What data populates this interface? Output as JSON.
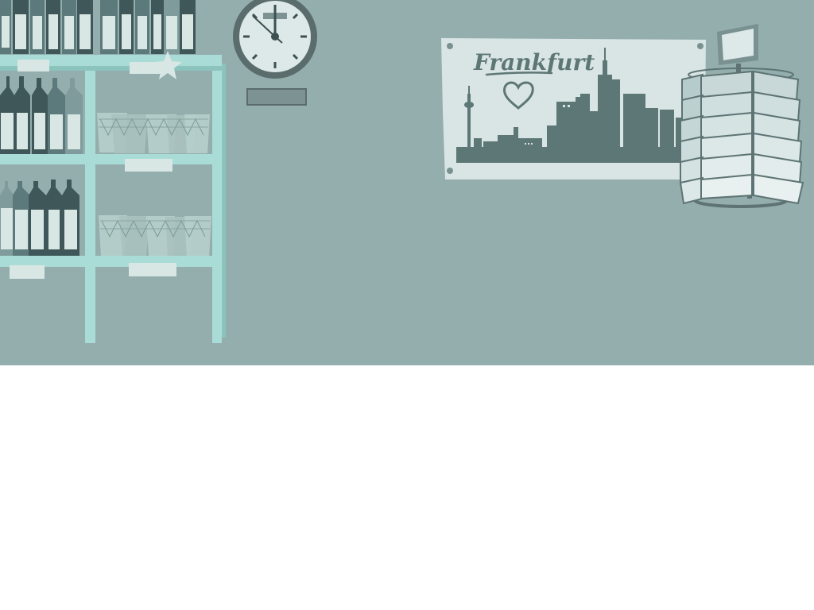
{
  "scene": {
    "poster": {
      "title": "Frankfurt"
    },
    "colors": {
      "wall": "#94aeae",
      "shelf": "#a9dcd6",
      "shelf_shadow": "#8cc4bd",
      "bottle_dark": "#3f5759",
      "bottle_mid": "#5c7a7b",
      "bottle_light": "#7f9b9b",
      "label": "#d8e6e4",
      "glass": "#b6cfcc",
      "poster_bg": "#d9e5e4",
      "skyline": "#5d7776",
      "clock_rim": "#5b6c6c",
      "clock_face": "#dde8e8",
      "rack_card": "#e2ecec",
      "rack_frame": "#5e7474"
    },
    "icons": [
      "star-icon",
      "heart-icon",
      "clock-icon"
    ]
  }
}
